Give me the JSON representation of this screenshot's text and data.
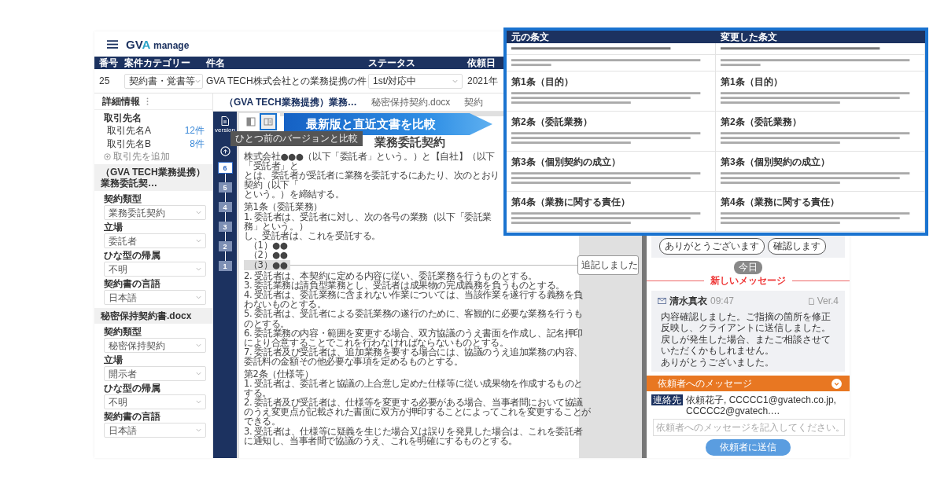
{
  "app": {
    "logo": {
      "main": "GV",
      "accent": "A",
      "suffix": "manage"
    }
  },
  "case_table": {
    "columns": [
      "番号",
      "案件カテゴリー",
      "件名",
      "ステータス",
      "依頼日"
    ],
    "row": {
      "number": "25",
      "category": "契約書・覚書等",
      "title": "GVA TECH株式会社との業務提携の件",
      "status": "1st/対応中",
      "date": "2021年"
    }
  },
  "sidebar": {
    "title": "詳細情報",
    "clients_label": "取引先名",
    "clients": [
      {
        "name": "取引先名A",
        "count": "12件"
      },
      {
        "name": "取引先名B",
        "count": "8件"
      }
    ],
    "add_client": "取引先を追加",
    "sections": [
      {
        "title": "（GVA TECH業務提携）業務委託契…",
        "fields": [
          {
            "label": "契約類型",
            "value": "業務委託契約"
          },
          {
            "label": "立場",
            "value": "委託者"
          },
          {
            "label": "ひな型の帰属",
            "value": "不明"
          },
          {
            "label": "契約書の言語",
            "value": "日本語"
          }
        ]
      },
      {
        "title": "秘密保持契約書.docx",
        "fields": [
          {
            "label": "契約類型",
            "value": "秘密保持契約"
          },
          {
            "label": "立場",
            "value": "開示者"
          },
          {
            "label": "ひな型の帰属",
            "value": "不明"
          },
          {
            "label": "契約書の言語",
            "value": "日本語"
          }
        ]
      }
    ]
  },
  "doc_tabs": [
    {
      "label": "（GVA TECH業務提携）業務…",
      "selected": true
    },
    {
      "label": "秘密保持契約.docx",
      "selected": false
    },
    {
      "label": "契約",
      "selected": false
    }
  ],
  "viewer": {
    "version_label": "version",
    "views": [
      {
        "selected": false
      },
      {
        "selected": true
      }
    ],
    "tooltip": "ひとつ前のバージョンと比較",
    "banner": "最新版と直近文書を比較",
    "versions": [
      {
        "label": "6",
        "selected": true
      },
      {
        "label": "5",
        "selected": false
      },
      {
        "label": "4",
        "selected": false
      },
      {
        "label": "3",
        "selected": false
      },
      {
        "label": "2",
        "selected": false
      },
      {
        "label": "1",
        "selected": false
      }
    ]
  },
  "document": {
    "title": "業務委託契約",
    "preamble": [
      "株式会社●●●（以下「委託者」という。）と【自社】（以下「受託者」と",
      "とは、委託者が受託者に業務を委託するにあたり、次のとおり契約（以下「",
      "という。）を締結する。"
    ],
    "articles": [
      {
        "heading": "第1条（委託業務）",
        "items": [
          {
            "kind": "clause",
            "highlighted": false,
            "lines": [
              "1. 委託者は、受託者に対し、次の各号の業務（以下「委託業務」という。）",
              "し、受託者は、これを受託する。"
            ]
          },
          {
            "kind": "sub",
            "highlighted": false,
            "lines": [
              "（1）●●"
            ]
          },
          {
            "kind": "sub",
            "highlighted": false,
            "lines": [
              "（2）●●"
            ]
          },
          {
            "kind": "sub",
            "highlighted": true,
            "lines": [
              "（3）●●"
            ]
          },
          {
            "kind": "clause",
            "highlighted": false,
            "lines": [
              "2. 受託者は、本契約に定める内容に従い、委託業務を行うものとする。"
            ]
          },
          {
            "kind": "clause",
            "highlighted": false,
            "lines": [
              "3. 委託業務は請負型業務とし、受託者は成果物の完成義務を負うものとする。"
            ]
          },
          {
            "kind": "clause",
            "highlighted": false,
            "lines": [
              "4. 受託者は、委託業務に含まれない作業については、当該作業を遂行する義務を負",
              "わないものとする。"
            ]
          },
          {
            "kind": "clause",
            "highlighted": false,
            "lines": [
              "5. 委託者は、受託者による委託業務の遂行のために、客観的に必要な業務を行うも",
              "のとする。"
            ]
          },
          {
            "kind": "clause",
            "highlighted": false,
            "lines": [
              "6. 委託業務の内容・範囲を変更する場合、双方協議のうえ書面を作成し、記名押印",
              "により合意することでこれを行わなければならないものとする。"
            ]
          },
          {
            "kind": "clause",
            "highlighted": false,
            "lines": [
              "7. 委託者及び受託者は、追加業務を要する場合には、協議のうえ追加業務の内容、",
              "委託料の金額その他必要な事項を定めるものとする。"
            ]
          }
        ]
      },
      {
        "heading": "第2条（仕様等）",
        "items": [
          {
            "kind": "clause",
            "highlighted": false,
            "lines": [
              "1. 受託者は、委託者と協議の上合意し定めた仕様等に従い成果物を作成するものと",
              "する。"
            ]
          },
          {
            "kind": "clause",
            "highlighted": false,
            "lines": [
              "2. 委託者及び受託者は、仕様等を変更する必要がある場合、当事者間において協議",
              "のうえ変更点が記載された書面に双方が押印することによってこれを変更することが",
              "できる。"
            ]
          },
          {
            "kind": "clause",
            "highlighted": false,
            "lines": [
              "3. 受託者は、仕様等に疑義を生じた場合又は誤りを発見した場合は、これを委託者",
              "に通知し、当事者間で協議のうえ、これを明確にするものとする。"
            ]
          }
        ]
      }
    ]
  },
  "comment": "追記しました",
  "messages": {
    "reactions": [
      "ありがとうございます",
      "確認します"
    ],
    "day": "今日",
    "new_label": "新しいメッセージ",
    "message": {
      "sender": "清水真衣",
      "time": "09:47",
      "version": "Ver.4",
      "paragraphs": [
        "内容確認しました。ご指摘の箇所を修正反映し、クライアントに送信しました。",
        "戻しが発生した場合、またご相談させていただくかもしれません。",
        "ありがとうございました。"
      ]
    }
  },
  "compose": {
    "title": "依頼者へのメッセージ",
    "recipients_label": "連絡先",
    "recipients": "依頼花子, CCCCC1@gvatech.co.jp, CCCCC2@gvatech.…",
    "placeholder": "依頼者へのメッセージを記入してください。",
    "send": "依頼者に送信"
  },
  "comparison": {
    "columns": [
      "元の条文",
      "変更した条文"
    ],
    "rows": [
      {
        "kind": "file"
      },
      {
        "kind": "intro"
      },
      {
        "kind": "article",
        "headings": [
          "第1条（目的）",
          "第1条（目的）"
        ]
      },
      {
        "kind": "article",
        "headings": [
          "第2条（委託業務）",
          "第2条（委託業務）"
        ]
      },
      {
        "kind": "article",
        "headings": [
          "第3条（個別契約の成立）",
          "第3条（個別契約の成立）"
        ]
      },
      {
        "kind": "article",
        "headings": [
          "第4条（業務に関する責任）",
          "第4条（業務に関する責任）"
        ]
      }
    ]
  }
}
